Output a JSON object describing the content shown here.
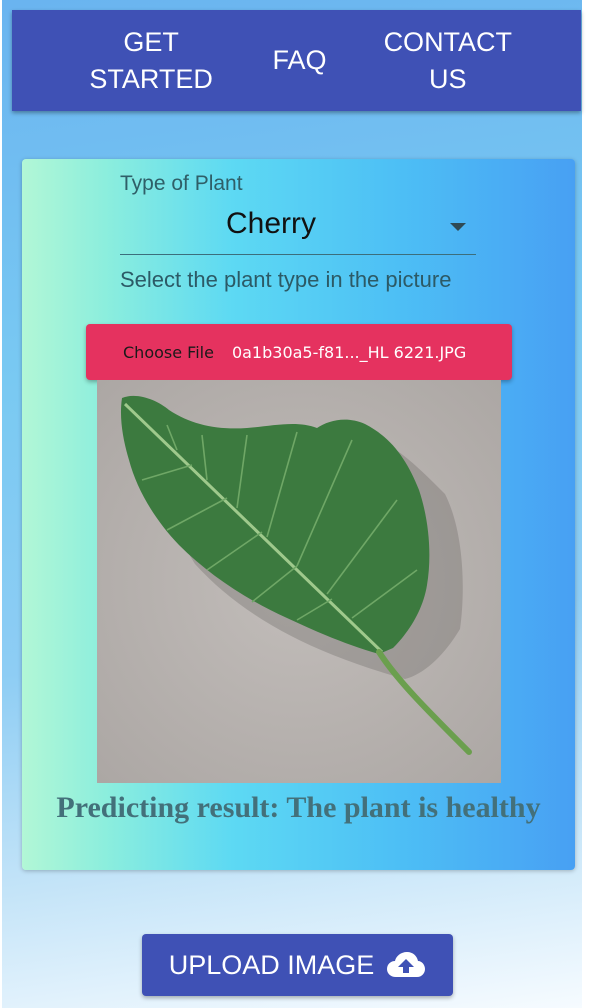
{
  "nav": {
    "items": [
      "GET STARTED",
      "FAQ",
      "CONTACT US"
    ],
    "color": "#3f51b5"
  },
  "form": {
    "plant_label": "Type of Plant",
    "plant_value": "Cherry",
    "helper_text": "Select the plant type in the picture",
    "choose_file_label": "Choose File",
    "file_name": "0a1b30a5-f81..._HL 6221.JPG",
    "file_bar_color": "#e5325f"
  },
  "result": {
    "text": "Predicting result: The plant is healthy"
  },
  "upload": {
    "label": "UPLOAD IMAGE",
    "icon": "cloud-upload-icon"
  }
}
